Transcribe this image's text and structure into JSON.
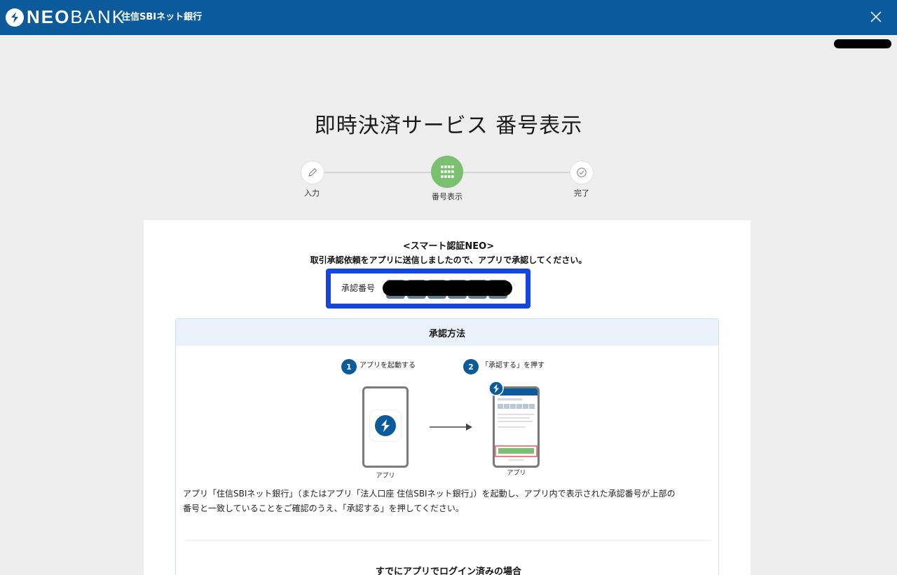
{
  "header": {
    "brand_neo": "NEO",
    "brand_bank": "BANK",
    "brand_sub": "住信SBIネット銀行",
    "close_icon": "close-icon",
    "bg_color": "#0a5a9c"
  },
  "page": {
    "title": "即時決済サービス 番号表示"
  },
  "stepper": {
    "steps": [
      {
        "label": "入力",
        "icon": "pencil-icon",
        "state": "done"
      },
      {
        "label": "番号表示",
        "icon": "keypad-icon",
        "state": "current"
      },
      {
        "label": "完了",
        "icon": "check-circle-icon",
        "state": "todo"
      }
    ],
    "active_color": "#7ac070"
  },
  "smart_auth": {
    "title": "<スマート認証NEO>",
    "description": "取引承認依頼をアプリに送信しましたので、アプリで承認してください。",
    "approval_label": "承認番号",
    "highlight_color": "#1446e0"
  },
  "method": {
    "heading": "承認方法",
    "step1_num": "1",
    "step1_text": "アプリを起動する",
    "step2_num": "2",
    "step2_text": "「承認する」を押す",
    "phone1_label": "アプリ",
    "phone2_label": "アプリ",
    "description_line1": "アプリ「住信SBIネット銀行」（またはアプリ「法人口座 住信SBIネット銀行」）を起動し、アプリ内で表示された承認番号が上部の",
    "description_line2": "番号と一致していることをご確認のうえ、「承認する」を押してください。",
    "logged_in_heading": "すでにアプリでログイン済みの場合"
  }
}
